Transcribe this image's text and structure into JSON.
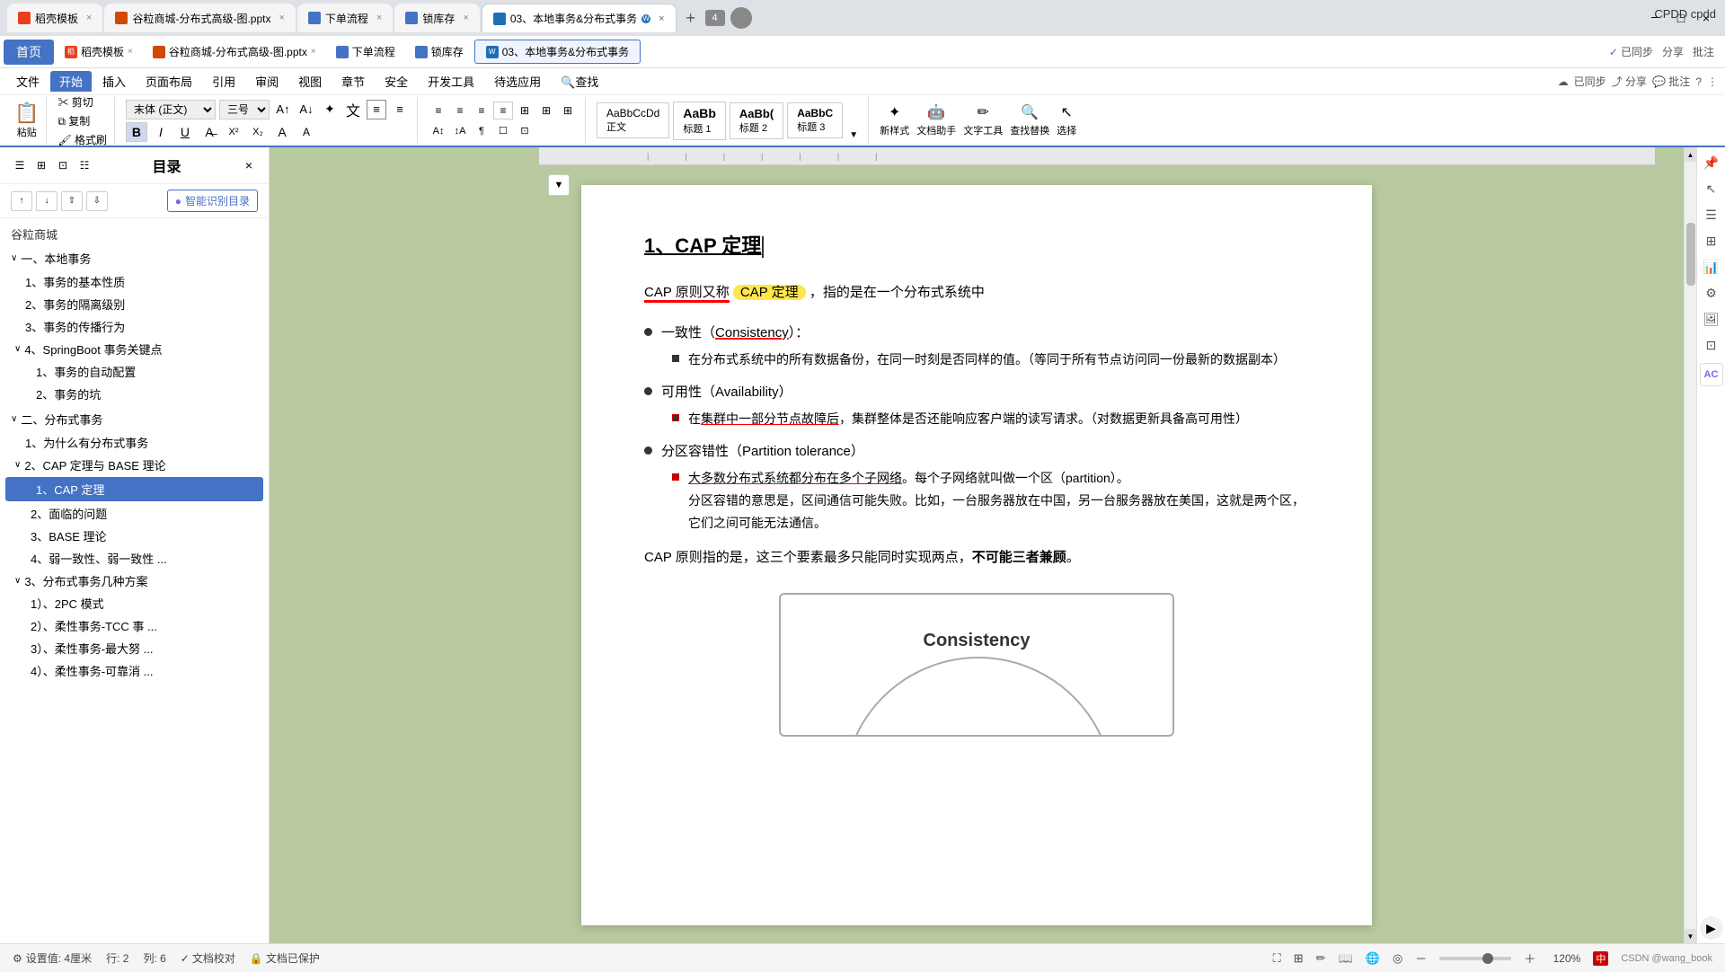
{
  "browser": {
    "tabs": [
      {
        "id": "tab1",
        "label": "稻壳模板",
        "color": "#e8401c",
        "active": false
      },
      {
        "id": "tab2",
        "label": "谷粒商城-分布式高级-图.pptx",
        "color": "#d04a02",
        "active": false
      },
      {
        "id": "tab3",
        "label": "下单流程",
        "color": "#4472c4",
        "active": false
      },
      {
        "id": "tab4",
        "label": "锁库存",
        "color": "#4472c4",
        "active": false
      },
      {
        "id": "tab5",
        "label": "03、本地事务&分布式事务",
        "color": "#4472c4",
        "active": true
      }
    ],
    "new_tab": "+",
    "tab_count": "4",
    "brand": "CPDD cpdd",
    "actions": [
      "－",
      "□",
      "×"
    ]
  },
  "appbar": {
    "home": "首页",
    "tabs": [
      {
        "label": "稻壳模板",
        "icon": "rice"
      },
      {
        "label": "谷粒商城-分布式高级-图.pptx",
        "icon": "ppt"
      },
      {
        "label": "下单流程",
        "icon": "flow"
      },
      {
        "label": "锁库存",
        "icon": "lock"
      },
      {
        "label": "03、本地事务&分布式事务",
        "icon": "doc",
        "active": true
      }
    ],
    "sync": "已同步",
    "share": "分享",
    "comment": "批注"
  },
  "toolbar": {
    "row1": {
      "menu_items": [
        "文件",
        "插入",
        "页面布局",
        "引用",
        "审阅",
        "视图",
        "章节",
        "安全",
        "开发工具",
        "待选应用",
        "查找"
      ],
      "active_tab": "开始",
      "right_actions": [
        "已同步",
        "分享",
        "批注"
      ]
    },
    "row2": {
      "clipboard": [
        "粘贴",
        "剪切",
        "复制",
        "格式刷"
      ],
      "font_name": "末体 (正文)",
      "font_size": "三号",
      "format_btns": [
        "B",
        "I",
        "U",
        "A",
        "X²",
        "X₂",
        "A",
        "A"
      ],
      "paragraph_btns": [
        "≡",
        "≡",
        "≡",
        "≡",
        "≡",
        "⊞",
        "⊞",
        "⊞"
      ]
    },
    "row3": {
      "styles": [
        "正文",
        "AaBbCcDd",
        "AaBb",
        "AaBb(",
        "AaBbC"
      ],
      "style_labels": [
        "正文",
        "标题1",
        "标题2",
        "标题3"
      ],
      "tools": [
        "新样式",
        "文档助手",
        "文字工具",
        "查找替换",
        "选择"
      ]
    }
  },
  "sidebar": {
    "title": "目录",
    "close_btn": "×",
    "ai_btn": "智能识别目录",
    "root": "谷粒商城",
    "items": [
      {
        "level": 1,
        "label": "一、本地事务",
        "toggle": "∨",
        "id": "local-tx"
      },
      {
        "level": 2,
        "label": "1、事务的基本性质",
        "id": "tx-basic"
      },
      {
        "level": 2,
        "label": "2、事务的隔离级别",
        "id": "tx-isolation"
      },
      {
        "level": 2,
        "label": "3、事务的传播行为",
        "id": "tx-propagation"
      },
      {
        "level": 2,
        "label": "4、SpringBoot 事务关键点",
        "toggle": "∨",
        "id": "springboot-tx"
      },
      {
        "level": 3,
        "label": "1、事务的自动配置",
        "id": "tx-auto-config"
      },
      {
        "level": 3,
        "label": "2、事务的坑",
        "id": "tx-pit"
      },
      {
        "level": 1,
        "label": "二、分布式事务",
        "toggle": "∨",
        "id": "dist-tx"
      },
      {
        "level": 2,
        "label": "1、为什么有分布式事务",
        "id": "why-dist"
      },
      {
        "level": 2,
        "label": "2、CAP 定理与 BASE 理论",
        "toggle": "∨",
        "id": "cap-base"
      },
      {
        "level": 3,
        "label": "1、CAP 定理",
        "id": "cap",
        "active": true
      },
      {
        "level": 3,
        "label": "2、面临的问题",
        "id": "cap-problems"
      },
      {
        "level": 3,
        "label": "3、BASE 理论",
        "id": "base"
      },
      {
        "level": 3,
        "label": "4、弱一致性、弱一致性 ...",
        "id": "weak-consistency"
      },
      {
        "level": 2,
        "label": "3、分布式事务几种方案",
        "toggle": "∨",
        "id": "dist-solutions"
      },
      {
        "level": 3,
        "label": "1）、2PC 模式",
        "id": "2pc"
      },
      {
        "level": 3,
        "label": "2）、柔性事务-TCC 事 ...",
        "id": "tcc"
      },
      {
        "level": 3,
        "label": "3）、柔性事务-最大努 ...",
        "id": "max-effort"
      },
      {
        "level": 3,
        "label": "4）、柔性事务-可靠消 ...",
        "id": "reliable-msg"
      }
    ]
  },
  "document": {
    "title": "1、CAP 定理",
    "intro": "CAP 原则又称 CAP 定理，指的是在一个分布式系统中",
    "sections": [
      {
        "type": "bullet",
        "label": "一致性（Consistency）：",
        "sub": "在分布式系统中的所有数据备份，在同一时刻是否同样的值。（等同于所有节点访问同一份最新的数据副本）"
      },
      {
        "type": "bullet",
        "label": "可用性（Availability）",
        "sub": "在集群中一部分节点故障后，集群整体是否还能响应客户端的读写请求。（对数据更新具备高可用性）"
      },
      {
        "type": "bullet",
        "label": "分区容错性（Partition tolerance）",
        "sub": "大多数分布式系统都分布在多个子网络。每个子网络就叫做一个区（partition）。分区容错的意思是，区间通信可能失败。比如，一台服务器放在中国，另一台服务器放在美国，这就是两个区，它们之间可能无法通信。"
      }
    ],
    "summary": "CAP 原则指的是，这三个要素最多只能同时实现两点，不可能三者兼顾。",
    "cap_diagram_label": "Consistency"
  },
  "status_bar": {
    "settings": "设置值: 4厘米",
    "row": "行: 2",
    "col": "列: 6",
    "doc_check": "文档校对",
    "doc_protected": "文档已保护",
    "zoom": "120%",
    "language": "中",
    "author": "CSDN @wang_book"
  },
  "right_panel_icons": [
    "≡",
    "□",
    "≡",
    "☰",
    "⊞",
    "☷",
    "≡",
    "⊗",
    "≡",
    "⊡",
    "⊞"
  ],
  "icons": {
    "search": "🔍",
    "gear": "⚙",
    "close": "×",
    "chevron_down": "∨",
    "chevron_right": "›",
    "check": "✓",
    "bullet": "●",
    "square": "■"
  }
}
